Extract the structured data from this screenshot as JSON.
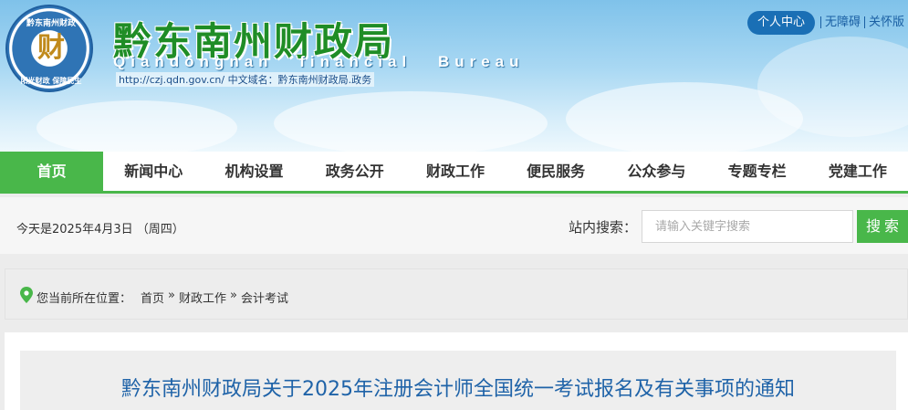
{
  "header": {
    "logo_top_text": "黔东南州财政",
    "logo_center_char": "财",
    "logo_bottom_text": "阳光财政 保障民生",
    "site_title": "黔东南州财政局",
    "site_subtitle": "Qiandongnan financial Bureau",
    "site_url": "http://czj.qdn.gov.cn/ 中文域名：黔东南州财政局.政务",
    "top_links": {
      "personal": "个人中心",
      "accessibility": "无障碍",
      "care": "关怀版"
    }
  },
  "nav": {
    "items": [
      "首页",
      "新闻中心",
      "机构设置",
      "政务公开",
      "财政工作",
      "便民服务",
      "公众参与",
      "专题专栏",
      "党建工作"
    ],
    "active_index": 0
  },
  "infobar": {
    "date": "今天是2025年4月3日 （周四）",
    "search_label": "站内搜索：",
    "search_placeholder": "请输入关键字搜索",
    "search_button": "搜索"
  },
  "breadcrumb": {
    "lead": "您当前所在位置：",
    "items": [
      "首页",
      "»",
      "财政工作",
      "»",
      "会计考试"
    ]
  },
  "article": {
    "title": "黔东南州财政局关于2025年注册会计师全国统一考试报名及有关事项的通知"
  },
  "colors": {
    "brand_green": "#49b74a",
    "title_blue": "#1f63a8",
    "personal_blue": "#1a6fb5"
  }
}
